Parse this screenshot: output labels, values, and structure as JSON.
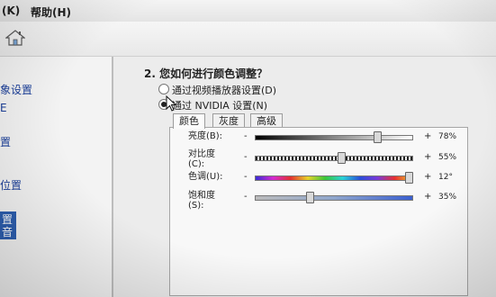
{
  "menu": {
    "items": [
      {
        "label": "(K)"
      },
      {
        "label": "帮助(H)"
      }
    ]
  },
  "toolbar": {
    "home_icon": "home-icon"
  },
  "sidebar": {
    "items": [
      {
        "label": "象设置"
      },
      {
        "label": "E"
      },
      {
        "label": "置"
      },
      {
        "label": "位置"
      },
      {
        "label": "置"
      },
      {
        "label": "音"
      }
    ],
    "selected_index": 5
  },
  "main": {
    "question": "2. 您如何进行颜色调整？",
    "options": [
      {
        "label": "通过视频播放器设置(D)",
        "selected": false
      },
      {
        "label": "通过 NVIDIA 设置(N)",
        "selected": true
      }
    ],
    "tabs": [
      {
        "label": "颜色",
        "active": true
      },
      {
        "label": "灰度",
        "active": false
      },
      {
        "label": "高级",
        "active": false
      }
    ],
    "sliders": [
      {
        "label": "亮度(B):",
        "minus": "-",
        "plus": "+",
        "value": "78%",
        "fraction": 0.78
      },
      {
        "label": "对比度\n(C):",
        "minus": "-",
        "plus": "+",
        "value": "55%",
        "fraction": 0.55
      },
      {
        "label": "色调(U):",
        "minus": "-",
        "plus": "+",
        "value": "12°",
        "fraction": 0.98
      },
      {
        "label": "饱和度\n(S):",
        "minus": "-",
        "plus": "+",
        "value": "35%",
        "fraction": 0.35
      }
    ]
  },
  "colors": {
    "selection": "#2d5fb0",
    "link": "#1b3f9a"
  }
}
